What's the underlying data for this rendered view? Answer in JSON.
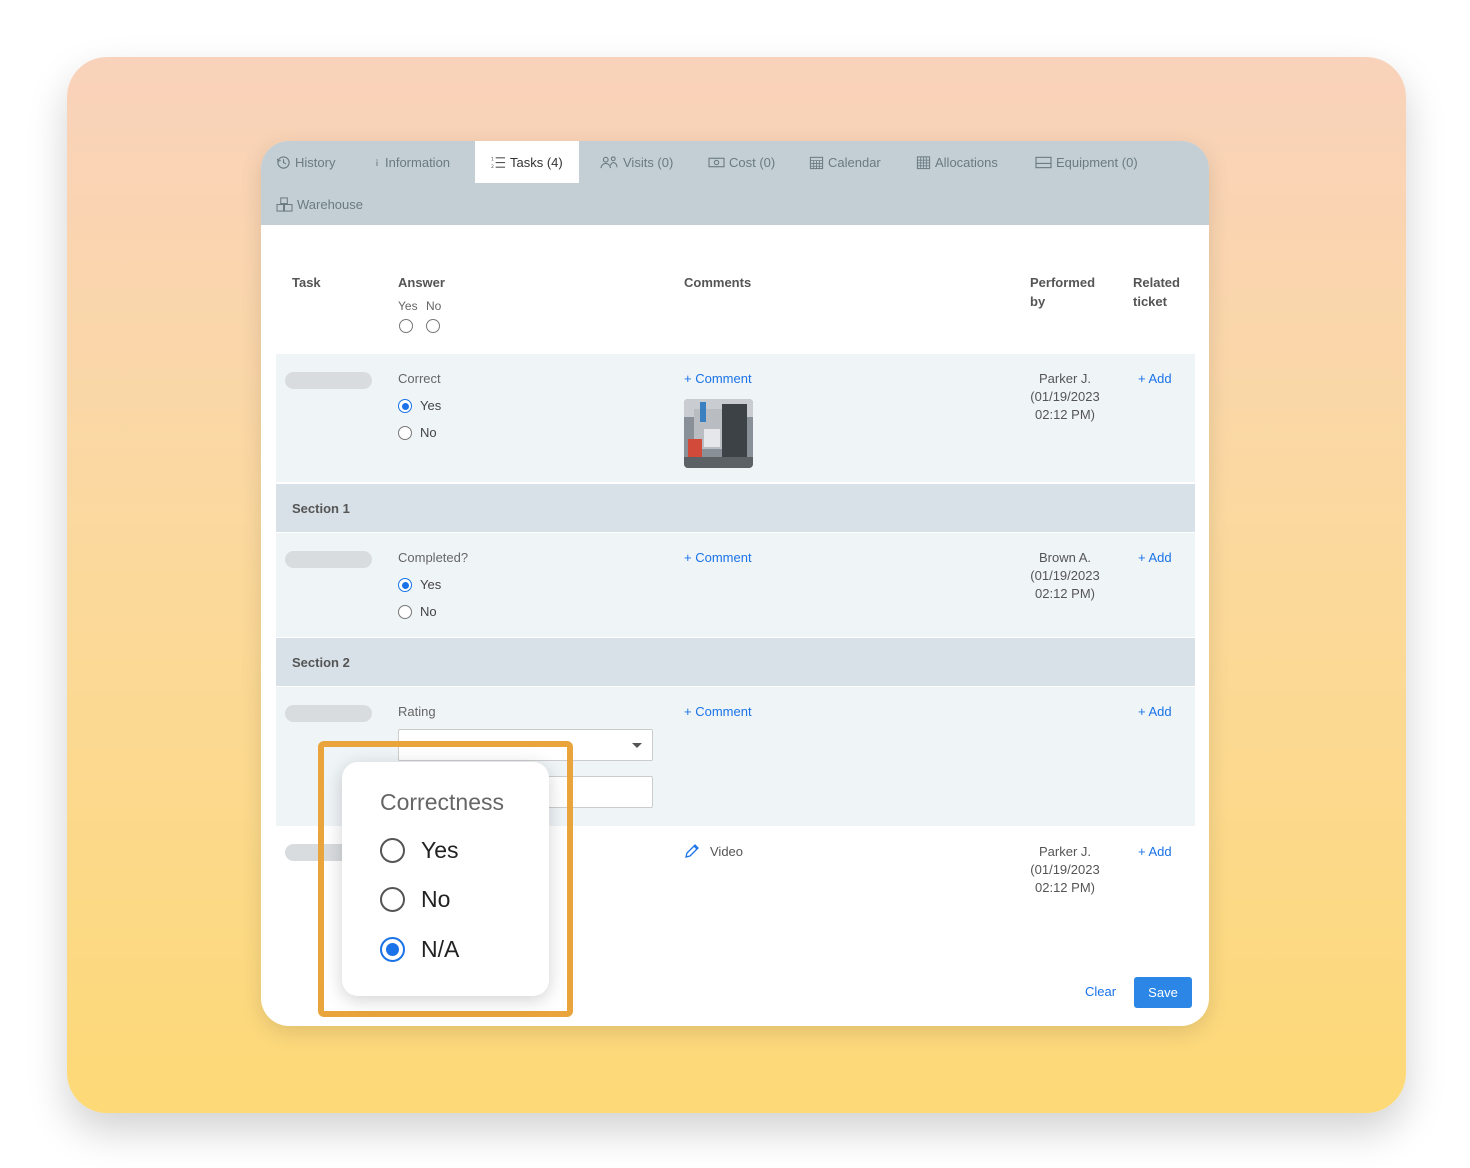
{
  "tabs": [
    {
      "label": "History",
      "icon": "history-icon"
    },
    {
      "label": "Information",
      "icon": "info-icon"
    },
    {
      "label": "Tasks (4)",
      "icon": "list-ordered-icon"
    },
    {
      "label": "Visits (0)",
      "icon": "users-icon"
    },
    {
      "label": "Cost (0)",
      "icon": "money-icon"
    },
    {
      "label": "Calendar",
      "icon": "calendar-icon"
    },
    {
      "label": "Allocations",
      "icon": "grid-icon"
    },
    {
      "label": "Equipment (0)",
      "icon": "equipment-icon"
    },
    {
      "label": "Warehouse",
      "icon": "boxes-icon"
    }
  ],
  "active_tab": "Tasks (4)",
  "table": {
    "headers": {
      "task": "Task",
      "answer": "Answer",
      "comments": "Comments",
      "performed_by_1": "Performed",
      "performed_by_2": "by",
      "related_1": "Related",
      "related_2": "ticket"
    },
    "answer_yes": "Yes",
    "answer_no": "No"
  },
  "rows": {
    "r1": {
      "question": "Correct",
      "yes": "Yes",
      "no": "No",
      "selected": "Yes",
      "comment_link": "+ Comment",
      "performer": "Parker J.",
      "date": "(01/19/2023",
      "time": "02:12 PM)",
      "add_link": "+ Add"
    },
    "section1": "Section 1",
    "r2": {
      "question": "Completed?",
      "yes": "Yes",
      "no": "No",
      "selected": "Yes",
      "comment_link": "+ Comment",
      "performer": "Brown A.",
      "date": "(01/19/2023",
      "time": "02:12 PM)",
      "add_link": "+ Add"
    },
    "section2": "Section 2",
    "r3": {
      "question": "Rating",
      "comment_link": "+ Comment",
      "add_link": "+ Add"
    },
    "r4": {
      "comment_link": "Video",
      "performer": "Parker J.",
      "date": "(01/19/2023",
      "time": "02:12 PM)",
      "add_link": "+ Add"
    }
  },
  "actions": {
    "clear": "Clear",
    "save": "Save"
  },
  "popup": {
    "title": "Correctness",
    "options": [
      "Yes",
      "No",
      "N/A"
    ],
    "selected": "N/A"
  },
  "colors": {
    "accent": "#1a73e8",
    "highlight": "#e9a53b",
    "tabbar": "#c3cfd5"
  }
}
